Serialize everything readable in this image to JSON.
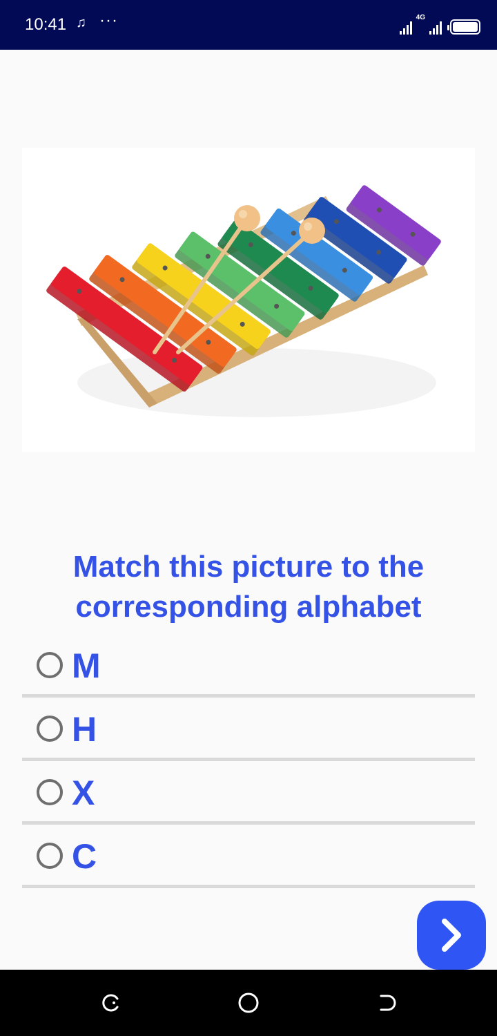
{
  "status_bar": {
    "time": "10:41",
    "music_icon": "♫",
    "more_dots": "···",
    "network_label": "4G",
    "background": "#020a55"
  },
  "picture": {
    "icon": "xylophone-image",
    "bar_colors": [
      "#e51e2e",
      "#f26a22",
      "#f7d21c",
      "#5cc06a",
      "#1f8a4f",
      "#3a8fe0",
      "#1f4fb3",
      "#8a3fc8"
    ]
  },
  "question": {
    "text": "Match this picture to the corresponding alphabet"
  },
  "options": [
    {
      "label": "M"
    },
    {
      "label": "H"
    },
    {
      "label": "X"
    },
    {
      "label": "C"
    }
  ],
  "next_button": {
    "icon": "chevron-right-icon",
    "color": "#2f55f5"
  },
  "nav_bar": {
    "icons": [
      "recent-apps-icon",
      "home-icon",
      "back-icon"
    ]
  },
  "accent_color": "#3552e6"
}
